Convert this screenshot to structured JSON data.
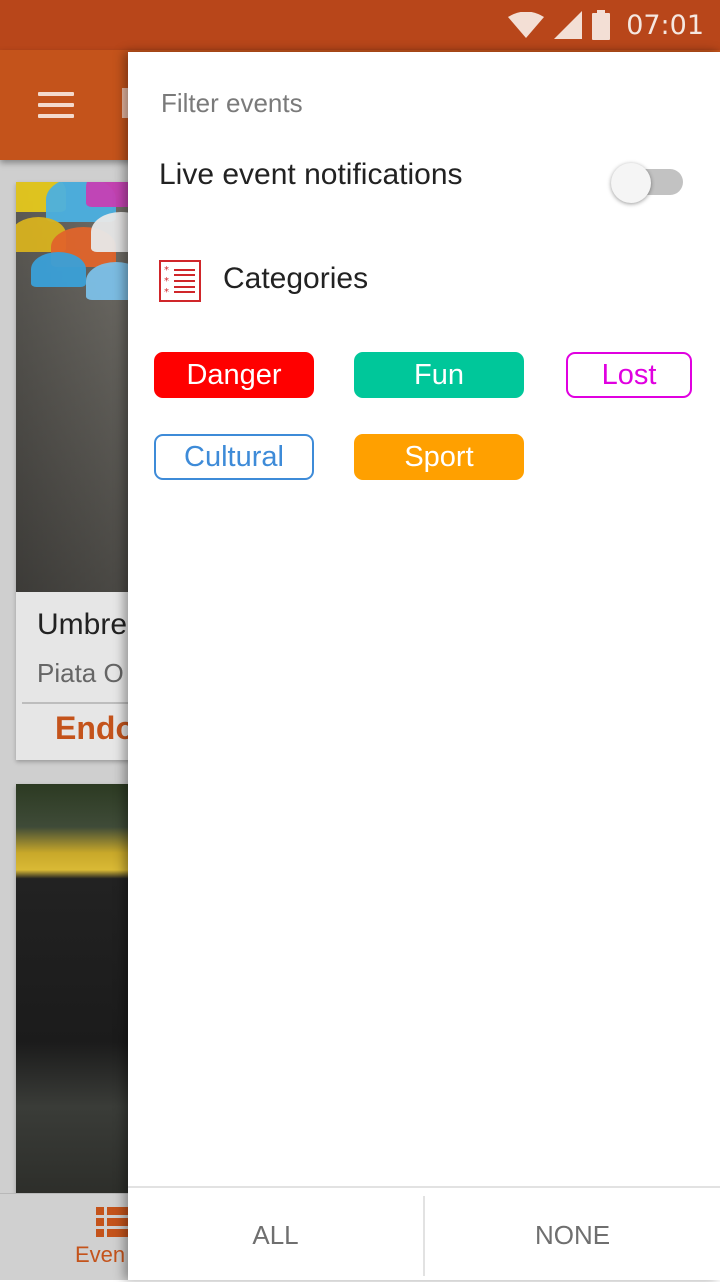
{
  "status_bar": {
    "time": "07:01",
    "icons": [
      "wifi-icon",
      "cell-signal-icon",
      "battery-icon"
    ]
  },
  "background": {
    "toolbar_color": "#c4531b",
    "cards": [
      {
        "title": "Umbre",
        "subtitle": "Piata O",
        "action": "Endo"
      }
    ],
    "bottom_nav": {
      "label": "Even",
      "icon": "list-icon"
    }
  },
  "drawer": {
    "title": "Filter events",
    "live_notifications": {
      "label": "Live event notifications",
      "enabled": false
    },
    "categories": {
      "label": "Categories",
      "icon": "category-list-icon",
      "chips": [
        {
          "label": "Danger",
          "selected": true,
          "color": "#ff0000"
        },
        {
          "label": "Fun",
          "selected": true,
          "color": "#00c79a"
        },
        {
          "label": "Lost",
          "selected": false,
          "color": "#e000e0"
        },
        {
          "label": "Cultural",
          "selected": false,
          "color": "#3e8bd8"
        },
        {
          "label": "Sport",
          "selected": true,
          "color": "#ffa000"
        }
      ]
    },
    "footer": {
      "all_label": "ALL",
      "none_label": "NONE"
    }
  }
}
